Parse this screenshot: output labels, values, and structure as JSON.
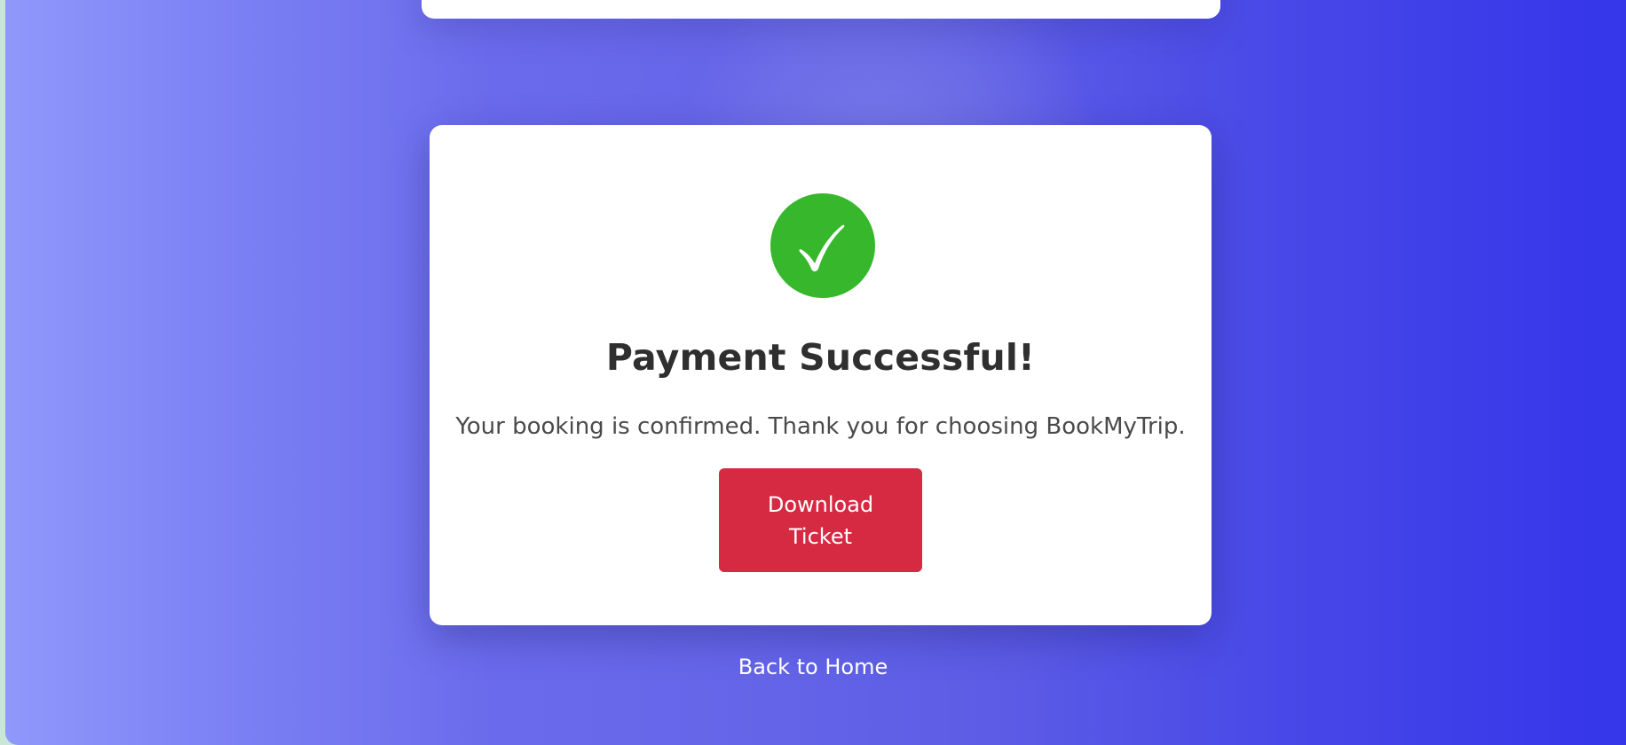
{
  "colors": {
    "background_start": "#9098fb",
    "background_end": "#3535ea",
    "success_green": "#36b72c",
    "button_red": "#d52a42",
    "card": "#ffffff"
  },
  "status": {
    "icon": "checkmark-icon",
    "title": "Payment Successful!",
    "message": "Your booking is confirmed. Thank you for choosing BookMyTrip."
  },
  "actions": {
    "download_label": "Download Ticket",
    "back_home_label": "Back to Home"
  }
}
